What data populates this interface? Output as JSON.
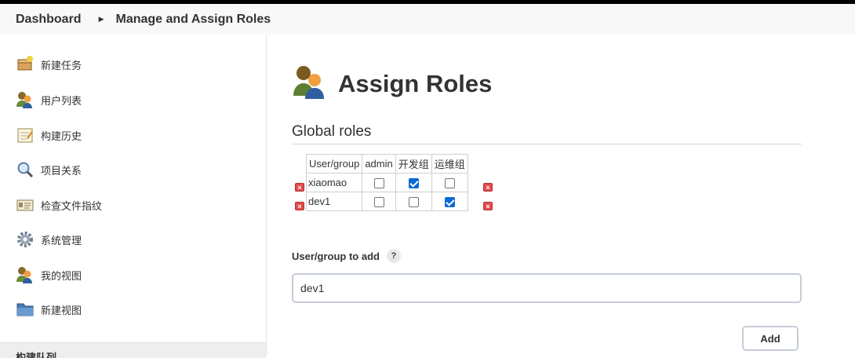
{
  "breadcrumb": {
    "home": "Dashboard",
    "current": "Manage and Assign Roles"
  },
  "sidebar": {
    "items": [
      {
        "label": "新建任务",
        "icon": "new-item-icon"
      },
      {
        "label": "用户列表",
        "icon": "users-icon"
      },
      {
        "label": "构建历史",
        "icon": "notepad-icon"
      },
      {
        "label": "项目关系",
        "icon": "search-icon"
      },
      {
        "label": "检查文件指纹",
        "icon": "fingerprint-icon"
      },
      {
        "label": "系统管理",
        "icon": "gear-icon"
      },
      {
        "label": "我的视图",
        "icon": "users-icon"
      },
      {
        "label": "新建视图",
        "icon": "folder-icon"
      }
    ],
    "footer": "构建队列"
  },
  "main": {
    "title": "Assign Roles",
    "section": "Global roles",
    "table": {
      "headers": [
        "User/group",
        "admin",
        "开发组",
        "运维组"
      ],
      "rows": [
        {
          "user": "xiaomao",
          "checks": [
            false,
            true,
            false
          ]
        },
        {
          "user": "dev1",
          "checks": [
            false,
            false,
            true
          ]
        }
      ]
    },
    "add_label": "User/group to add",
    "help_symbol": "?",
    "input_value": "dev1",
    "add_button": "Add"
  },
  "colors": {
    "checkbox_checked": "#0b6bd6",
    "delete": "#e64b4b"
  }
}
